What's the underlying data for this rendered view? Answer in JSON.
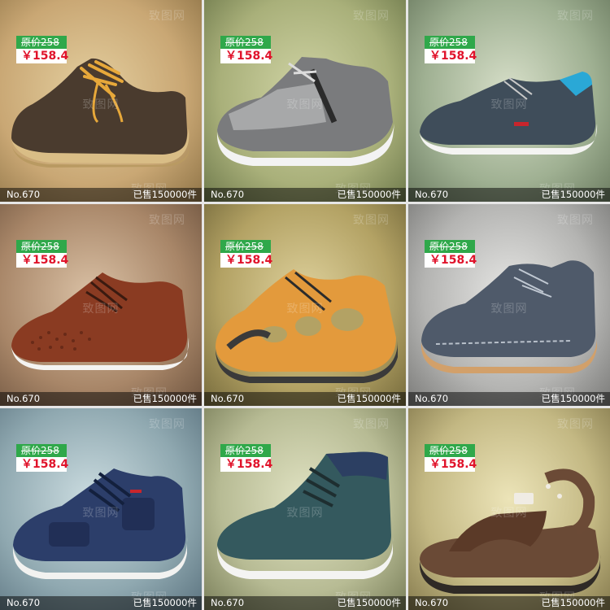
{
  "watermark": "致图网",
  "products": [
    {
      "original_price": "原价258",
      "price": "￥158.4",
      "number": "No.670",
      "sold": "已售150000件",
      "shoe_icon": "brown-suede-derby-shoe-icon",
      "bg": "#c9a774"
    },
    {
      "original_price": "原价258",
      "price": "￥158.4",
      "number": "No.670",
      "sold": "已售150000件",
      "shoe_icon": "grey-mesh-sneaker-icon",
      "bg": "#a9b07a"
    },
    {
      "original_price": "原价258",
      "price": "￥158.4",
      "number": "No.670",
      "sold": "已售150000件",
      "shoe_icon": "navy-suede-sneaker-icon",
      "bg": "#9fb092"
    },
    {
      "original_price": "原价258",
      "price": "￥158.4",
      "number": "No.670",
      "sold": "已售150000件",
      "shoe_icon": "perforated-brown-leather-shoe-icon",
      "bg": "#a88668"
    },
    {
      "original_price": "原价258",
      "price": "￥158.4",
      "number": "No.670",
      "sold": "已售150000件",
      "shoe_icon": "orange-sport-sandal-icon",
      "bg": "#b3a264"
    },
    {
      "original_price": "原价258",
      "price": "￥158.4",
      "number": "No.670",
      "sold": "已售150000件",
      "shoe_icon": "grey-suede-boot-shoe-icon",
      "bg": "#b4b4b2"
    },
    {
      "original_price": "原价258",
      "price": "￥158.4",
      "number": "No.670",
      "sold": "已售150000件",
      "shoe_icon": "navy-mesh-leather-sneaker-icon",
      "bg": "#8fa8b0"
    },
    {
      "original_price": "原价258",
      "price": "￥158.4",
      "number": "No.670",
      "sold": "已售150000件",
      "shoe_icon": "teal-suede-high-top-icon",
      "bg": "#b7bb94"
    },
    {
      "original_price": "原价258",
      "price": "￥158.4",
      "number": "No.670",
      "sold": "已售150000件",
      "shoe_icon": "brown-leather-sandal-icon",
      "bg": "#c3b883"
    }
  ]
}
